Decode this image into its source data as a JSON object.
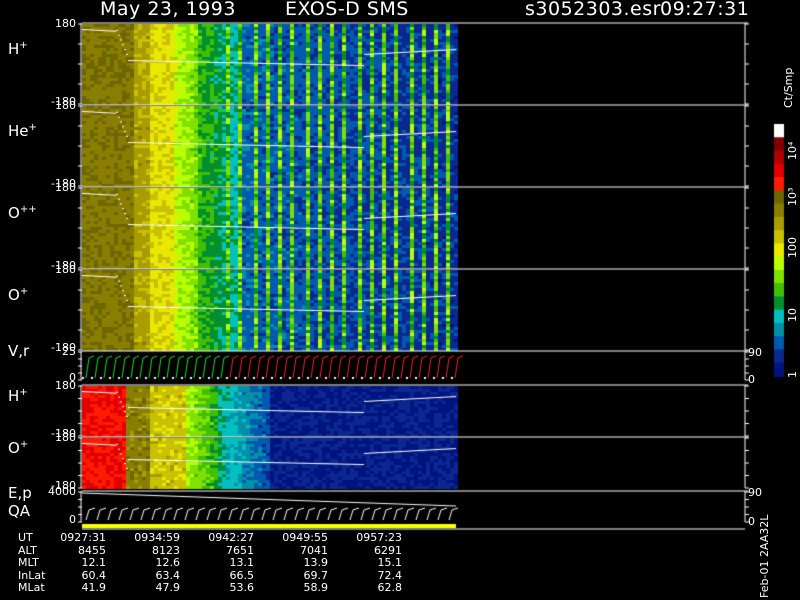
{
  "header": {
    "date": "May 23, 1993",
    "instrument": "EXOS-D SMS",
    "file": "s3052303.esr",
    "time": "09:27:31"
  },
  "colorbar": {
    "unit_label": "Ct/Smp",
    "tick_labels": [
      "10⁴",
      "10³",
      "100",
      "10",
      "1"
    ],
    "colors": [
      "#ffffff",
      "#800000",
      "#b00000",
      "#e00000",
      "#ff1a00",
      "#6e6600",
      "#8a7e00",
      "#a89c00",
      "#c8c000",
      "#e8e800",
      "#b8ff00",
      "#80e000",
      "#40c000",
      "#009030",
      "#00c0c0",
      "#0090a8",
      "#005ab0",
      "#0a2890",
      "#001480"
    ]
  },
  "panels": [
    {
      "label": "H",
      "sup": "+",
      "y_top": "180",
      "y_bot": "-180",
      "kind": "pa_hi"
    },
    {
      "label": "He",
      "sup": "+",
      "y_top": "180",
      "y_bot": "-180",
      "kind": "pa_hi"
    },
    {
      "label": "O",
      "sup": "++",
      "y_top": "180",
      "y_bot": "-180",
      "kind": "pa_hi"
    },
    {
      "label": "O",
      "sup": "+",
      "y_top": "180",
      "y_bot": "-180",
      "kind": "pa_hi"
    },
    {
      "label": "V,r",
      "sup": "",
      "y_top": "25",
      "y_bot": "0",
      "kind": "vr",
      "r_top": "90",
      "r_bot": "0"
    },
    {
      "label": "H",
      "sup": "+",
      "y_top": "180",
      "y_bot": "-180",
      "kind": "pa_lo"
    },
    {
      "label": "O",
      "sup": "+",
      "y_top": "180",
      "y_bot": "-180",
      "kind": "pa_lo"
    },
    {
      "label": "E,p",
      "label2": "QA",
      "sup": "",
      "y_top": "4000",
      "y_bot": "0",
      "kind": "ep",
      "r_top": "90",
      "r_bot": "0"
    }
  ],
  "orbit_table": {
    "row_labels": [
      "UT",
      "ALT",
      "MLT",
      "InLat",
      "MLat"
    ],
    "columns": [
      {
        "UT": "0927:31",
        "ALT": "8455",
        "MLT": "12.1",
        "InLat": "60.4",
        "MLat": "41.9"
      },
      {
        "UT": "0934:59",
        "ALT": "8123",
        "MLT": "12.6",
        "InLat": "63.4",
        "MLat": "47.9"
      },
      {
        "UT": "0942:27",
        "ALT": "7651",
        "MLT": "13.1",
        "InLat": "66.5",
        "MLat": "53.6"
      },
      {
        "UT": "0949:55",
        "ALT": "7041",
        "MLT": "13.9",
        "InLat": "69.7",
        "MLat": "58.9"
      },
      {
        "UT": "0957:23",
        "ALT": "6291",
        "MLT": "15.1",
        "InLat": "72.4",
        "MLat": "62.8"
      }
    ]
  },
  "version_label": "Feb-01 2AA32L",
  "chart_data": {
    "type": "heatmap",
    "title": "May 23, 1993   EXOS-D SMS",
    "xlabel": "UT",
    "x_ticks": [
      "0927:31",
      "0934:59",
      "0942:27",
      "0949:55",
      "0957:23"
    ],
    "panels": [
      "H+",
      "He+",
      "O++",
      "O+",
      "V,r",
      "H+",
      "O+",
      "E,p QA"
    ],
    "ylim_pitch_angle": [
      -180,
      180
    ],
    "ylim_v": [
      0,
      25
    ],
    "ylim_r": [
      0,
      90
    ],
    "ylim_e": [
      0,
      4000
    ],
    "colorscale_counts": [
      1,
      10,
      100,
      1000,
      10000
    ],
    "grid": false
  }
}
